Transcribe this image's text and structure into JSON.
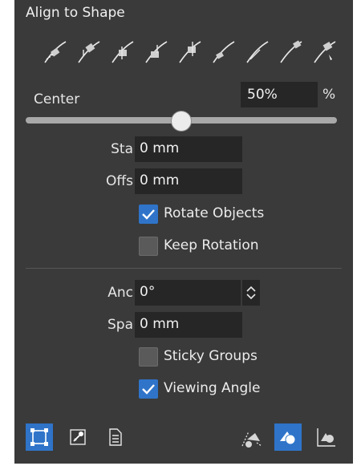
{
  "panel": {
    "title": "Align to Shape"
  },
  "align_modes": [
    {
      "icon": "align-mode-1-icon"
    },
    {
      "icon": "align-mode-2-icon"
    },
    {
      "icon": "align-mode-3-icon"
    },
    {
      "icon": "align-mode-4-icon"
    },
    {
      "icon": "align-mode-5-icon"
    },
    {
      "icon": "align-mode-6-icon"
    },
    {
      "icon": "align-mode-7-icon"
    },
    {
      "icon": "align-mode-8-icon"
    },
    {
      "icon": "align-mode-9-icon"
    }
  ],
  "position": {
    "label": "Center",
    "value": "50%",
    "unit": "%",
    "slider_fraction": 0.5
  },
  "start": {
    "label": "Sta",
    "value": "0 mm"
  },
  "offset": {
    "label": "Offs",
    "value": "0 mm"
  },
  "rotate_objects": {
    "label": "Rotate Objects",
    "checked": true
  },
  "keep_rotation": {
    "label": "Keep Rotation",
    "checked": false
  },
  "angle": {
    "label": "Anc",
    "value": "0°"
  },
  "spacing": {
    "label": "Spa",
    "value": "0 mm"
  },
  "sticky_groups": {
    "label": "Sticky Groups",
    "checked": false
  },
  "viewing_angle": {
    "label": "Viewing Angle",
    "checked": true
  },
  "toolbar": {
    "left": [
      "frame-select-icon",
      "key-icon",
      "document-icon"
    ],
    "right": [
      "object-on-path-icon",
      "shape-overlap-icon",
      "shape-above-path-icon"
    ],
    "active": [
      "frame-select-icon",
      "shape-overlap-icon"
    ]
  },
  "colors": {
    "panel": "#3a3a3a",
    "field": "#262626",
    "accent": "#2f74c9",
    "text": "#e6e6e6"
  }
}
